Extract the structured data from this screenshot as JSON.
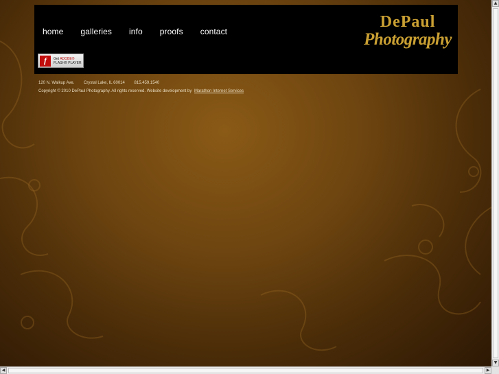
{
  "nav": {
    "items": [
      {
        "label": "home"
      },
      {
        "label": "galleries"
      },
      {
        "label": "info"
      },
      {
        "label": "proofs"
      },
      {
        "label": "contact"
      }
    ]
  },
  "logo": {
    "line1": "DePaul",
    "line2": "Photography"
  },
  "flash": {
    "icon": "f",
    "get": "Get",
    "adobe": "ADOBE®",
    "player": "FLASH® PLAYER"
  },
  "footer": {
    "address": "120 N. Walkup Ave.",
    "city": "Crystal Lake, IL 60014",
    "phone": "815.459.1540",
    "copyright": "Copyright © 2010 DePaul Photography. All rights reserved. Website development by",
    "dev_link": "Marathon Internet Services"
  },
  "scrollbars": {
    "up": "▲",
    "down": "▼",
    "left": "◀",
    "right": "▶"
  },
  "colors": {
    "brand_gold": "#caa033",
    "header_bg": "#000000",
    "nav_text": "#ffffff"
  }
}
